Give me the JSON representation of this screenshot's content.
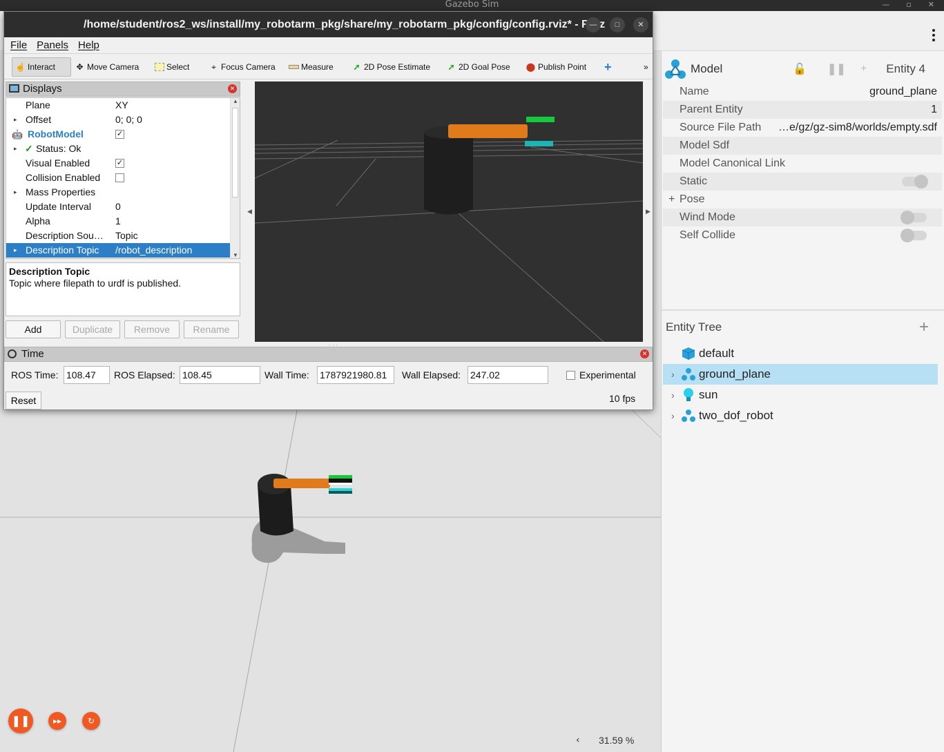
{
  "gazebo": {
    "window_title": "Gazebo Sim",
    "component_inspector": {
      "title": "Model",
      "entity_label": "Entity 4",
      "properties": [
        {
          "key": "Name",
          "value": "ground_plane"
        },
        {
          "key": "Parent Entity",
          "value": "1"
        },
        {
          "key": "Source File Path",
          "value": "…e/gz/gz-sim8/worlds/empty.sdf"
        },
        {
          "key": "Model Sdf",
          "value": ""
        },
        {
          "key": "Model Canonical Link",
          "value": ""
        },
        {
          "key": "Static",
          "value": ""
        },
        {
          "key": "Pose",
          "value": ""
        },
        {
          "key": "Wind Mode",
          "value": ""
        },
        {
          "key": "Self Collide",
          "value": ""
        }
      ],
      "pose_prefix": "+"
    },
    "entity_tree": {
      "title": "Entity Tree",
      "add_symbol": "+",
      "items": [
        {
          "label": "default",
          "icon": "cube-icon"
        },
        {
          "label": "ground_plane",
          "icon": "model-icon"
        },
        {
          "label": "sun",
          "icon": "light-bulb-icon"
        },
        {
          "label": "two_dof_robot",
          "icon": "model-icon"
        }
      ]
    },
    "zoom": "31.59 %",
    "accent_color": "#f05a22"
  },
  "rviz": {
    "window_title": "/home/student/ros2_ws/install/my_robotarm_pkg/share/my_robotarm_pkg/config/config.rviz* - RViz",
    "menu": [
      "File",
      "Panels",
      "Help"
    ],
    "tools": [
      "Interact",
      "Move Camera",
      "Select",
      "Focus Camera",
      "Measure",
      "2D Pose Estimate",
      "2D Goal Pose",
      "Publish Point"
    ],
    "more_symbol": "»",
    "displays": {
      "title": "Displays",
      "rows": [
        {
          "key": "Plane",
          "value": "XY"
        },
        {
          "key": "Offset",
          "value": "0; 0; 0"
        },
        {
          "key": "RobotModel",
          "value": ""
        },
        {
          "key": "Status: Ok",
          "value": ""
        },
        {
          "key": "Visual Enabled",
          "value": ""
        },
        {
          "key": "Collision Enabled",
          "value": ""
        },
        {
          "key": "Mass Properties",
          "value": ""
        },
        {
          "key": "Update Interval",
          "value": "0"
        },
        {
          "key": "Alpha",
          "value": "1"
        },
        {
          "key": "Description Sou…",
          "value": "Topic"
        },
        {
          "key": "Description Topic",
          "value": "/robot_description"
        }
      ],
      "description_title": "Description Topic",
      "description_body": "Topic where filepath to urdf is published.",
      "buttons": [
        "Add",
        "Duplicate",
        "Remove",
        "Rename"
      ]
    },
    "time": {
      "title": "Time",
      "ros_time_label": "ROS Time:",
      "ros_time": "108.47",
      "ros_elapsed_label": "ROS Elapsed:",
      "ros_elapsed": "108.45",
      "wall_time_label": "Wall Time:",
      "wall_time": "1787921980.81",
      "wall_elapsed_label": "Wall Elapsed:",
      "wall_elapsed": "247.02",
      "experimental_label": "Experimental",
      "reset_label": "Reset",
      "fps": "10 fps"
    }
  }
}
